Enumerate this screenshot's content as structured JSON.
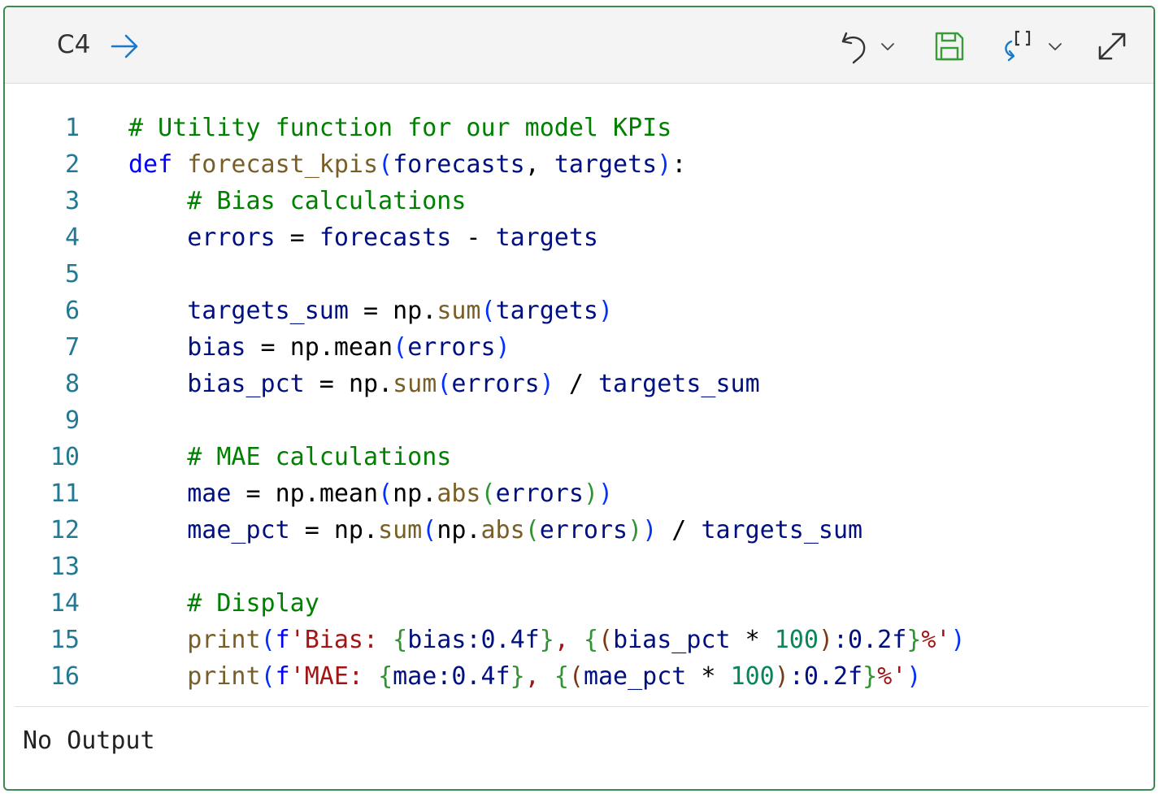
{
  "cell": {
    "id": "C4"
  },
  "toolbar": {
    "run_icon": "arrow-right-icon",
    "undo_icon": "undo-icon",
    "save_icon": "save-icon",
    "variables_icon": "variables-refresh-icon",
    "expand_icon": "expand-icon"
  },
  "colors": {
    "border": "#3a8a52",
    "line_number": "#237893",
    "comment": "#008000",
    "keyword": "#0000ff",
    "function": "#795e26",
    "variable": "#001080",
    "number": "#098658",
    "string": "#a31515",
    "bracket_1": "#0431fa",
    "bracket_2": "#319331",
    "bracket_3": "#7b3814"
  },
  "code": {
    "lines": [
      {
        "n": "1",
        "tokens": [
          {
            "t": "# Utility function for our model KPIs",
            "c": "comment"
          }
        ]
      },
      {
        "n": "2",
        "tokens": [
          {
            "t": "def",
            "c": "keyword"
          },
          {
            "t": " ",
            "c": "plain"
          },
          {
            "t": "forecast_kpis",
            "c": "function"
          },
          {
            "t": "(",
            "c": "bracket_1"
          },
          {
            "t": "forecasts",
            "c": "variable"
          },
          {
            "t": ", ",
            "c": "plain"
          },
          {
            "t": "targets",
            "c": "variable"
          },
          {
            "t": ")",
            "c": "bracket_1"
          },
          {
            "t": ":",
            "c": "plain"
          }
        ]
      },
      {
        "n": "3",
        "tokens": [
          {
            "t": "    ",
            "c": "plain"
          },
          {
            "t": "# Bias calculations",
            "c": "comment"
          }
        ]
      },
      {
        "n": "4",
        "tokens": [
          {
            "t": "    ",
            "c": "plain"
          },
          {
            "t": "errors",
            "c": "variable"
          },
          {
            "t": " = ",
            "c": "plain"
          },
          {
            "t": "forecasts",
            "c": "variable"
          },
          {
            "t": " - ",
            "c": "plain"
          },
          {
            "t": "targets",
            "c": "variable"
          }
        ]
      },
      {
        "n": "5",
        "tokens": []
      },
      {
        "n": "6",
        "tokens": [
          {
            "t": "    ",
            "c": "plain"
          },
          {
            "t": "targets_sum",
            "c": "variable"
          },
          {
            "t": " = ",
            "c": "plain"
          },
          {
            "t": "np",
            "c": "plain"
          },
          {
            "t": ".",
            "c": "plain"
          },
          {
            "t": "sum",
            "c": "function"
          },
          {
            "t": "(",
            "c": "bracket_1"
          },
          {
            "t": "targets",
            "c": "variable"
          },
          {
            "t": ")",
            "c": "bracket_1"
          }
        ]
      },
      {
        "n": "7",
        "tokens": [
          {
            "t": "    ",
            "c": "plain"
          },
          {
            "t": "bias",
            "c": "variable"
          },
          {
            "t": " = ",
            "c": "plain"
          },
          {
            "t": "np",
            "c": "plain"
          },
          {
            "t": ".",
            "c": "plain"
          },
          {
            "t": "mean",
            "c": "plain"
          },
          {
            "t": "(",
            "c": "bracket_1"
          },
          {
            "t": "errors",
            "c": "variable"
          },
          {
            "t": ")",
            "c": "bracket_1"
          }
        ]
      },
      {
        "n": "8",
        "tokens": [
          {
            "t": "    ",
            "c": "plain"
          },
          {
            "t": "bias_pct",
            "c": "variable"
          },
          {
            "t": " = ",
            "c": "plain"
          },
          {
            "t": "np",
            "c": "plain"
          },
          {
            "t": ".",
            "c": "plain"
          },
          {
            "t": "sum",
            "c": "function"
          },
          {
            "t": "(",
            "c": "bracket_1"
          },
          {
            "t": "errors",
            "c": "variable"
          },
          {
            "t": ")",
            "c": "bracket_1"
          },
          {
            "t": " / ",
            "c": "plain"
          },
          {
            "t": "targets_sum",
            "c": "variable"
          }
        ]
      },
      {
        "n": "9",
        "tokens": []
      },
      {
        "n": "10",
        "tokens": [
          {
            "t": "    ",
            "c": "plain"
          },
          {
            "t": "# MAE calculations",
            "c": "comment"
          }
        ]
      },
      {
        "n": "11",
        "tokens": [
          {
            "t": "    ",
            "c": "plain"
          },
          {
            "t": "mae",
            "c": "variable"
          },
          {
            "t": " = ",
            "c": "plain"
          },
          {
            "t": "np",
            "c": "plain"
          },
          {
            "t": ".",
            "c": "plain"
          },
          {
            "t": "mean",
            "c": "plain"
          },
          {
            "t": "(",
            "c": "bracket_1"
          },
          {
            "t": "np",
            "c": "plain"
          },
          {
            "t": ".",
            "c": "plain"
          },
          {
            "t": "abs",
            "c": "function"
          },
          {
            "t": "(",
            "c": "bracket_2"
          },
          {
            "t": "errors",
            "c": "variable"
          },
          {
            "t": ")",
            "c": "bracket_2"
          },
          {
            "t": ")",
            "c": "bracket_1"
          }
        ]
      },
      {
        "n": "12",
        "tokens": [
          {
            "t": "    ",
            "c": "plain"
          },
          {
            "t": "mae_pct",
            "c": "variable"
          },
          {
            "t": " = ",
            "c": "plain"
          },
          {
            "t": "np",
            "c": "plain"
          },
          {
            "t": ".",
            "c": "plain"
          },
          {
            "t": "sum",
            "c": "function"
          },
          {
            "t": "(",
            "c": "bracket_1"
          },
          {
            "t": "np",
            "c": "plain"
          },
          {
            "t": ".",
            "c": "plain"
          },
          {
            "t": "abs",
            "c": "function"
          },
          {
            "t": "(",
            "c": "bracket_2"
          },
          {
            "t": "errors",
            "c": "variable"
          },
          {
            "t": ")",
            "c": "bracket_2"
          },
          {
            "t": ")",
            "c": "bracket_1"
          },
          {
            "t": " / ",
            "c": "plain"
          },
          {
            "t": "targets_sum",
            "c": "variable"
          }
        ]
      },
      {
        "n": "13",
        "tokens": []
      },
      {
        "n": "14",
        "tokens": [
          {
            "t": "    ",
            "c": "plain"
          },
          {
            "t": "# Display",
            "c": "comment"
          }
        ]
      },
      {
        "n": "15",
        "tokens": [
          {
            "t": "    ",
            "c": "plain"
          },
          {
            "t": "print",
            "c": "function"
          },
          {
            "t": "(",
            "c": "bracket_1"
          },
          {
            "t": "f",
            "c": "keyword"
          },
          {
            "t": "'Bias: ",
            "c": "string"
          },
          {
            "t": "{",
            "c": "bracket_2"
          },
          {
            "t": "bias",
            "c": "variable"
          },
          {
            "t": ":0.4f",
            "c": "variable"
          },
          {
            "t": "}",
            "c": "bracket_2"
          },
          {
            "t": ", ",
            "c": "string"
          },
          {
            "t": "{",
            "c": "bracket_2"
          },
          {
            "t": "(",
            "c": "bracket_3"
          },
          {
            "t": "bias_pct",
            "c": "variable"
          },
          {
            "t": " * ",
            "c": "plain"
          },
          {
            "t": "100",
            "c": "number"
          },
          {
            "t": ")",
            "c": "bracket_3"
          },
          {
            "t": ":0.2f",
            "c": "variable"
          },
          {
            "t": "}",
            "c": "bracket_2"
          },
          {
            "t": "%'",
            "c": "string"
          },
          {
            "t": ")",
            "c": "bracket_1"
          }
        ]
      },
      {
        "n": "16",
        "tokens": [
          {
            "t": "    ",
            "c": "plain"
          },
          {
            "t": "print",
            "c": "function"
          },
          {
            "t": "(",
            "c": "bracket_1"
          },
          {
            "t": "f",
            "c": "keyword"
          },
          {
            "t": "'MAE: ",
            "c": "string"
          },
          {
            "t": "{",
            "c": "bracket_2"
          },
          {
            "t": "mae",
            "c": "variable"
          },
          {
            "t": ":0.4f",
            "c": "variable"
          },
          {
            "t": "}",
            "c": "bracket_2"
          },
          {
            "t": ", ",
            "c": "string"
          },
          {
            "t": "{",
            "c": "bracket_2"
          },
          {
            "t": "(",
            "c": "bracket_3"
          },
          {
            "t": "mae_pct",
            "c": "variable"
          },
          {
            "t": " * ",
            "c": "plain"
          },
          {
            "t": "100",
            "c": "number"
          },
          {
            "t": ")",
            "c": "bracket_3"
          },
          {
            "t": ":0.2f",
            "c": "variable"
          },
          {
            "t": "}",
            "c": "bracket_2"
          },
          {
            "t": "%'",
            "c": "string"
          },
          {
            "t": ")",
            "c": "bracket_1"
          }
        ]
      }
    ]
  },
  "output": {
    "text": "No Output"
  }
}
